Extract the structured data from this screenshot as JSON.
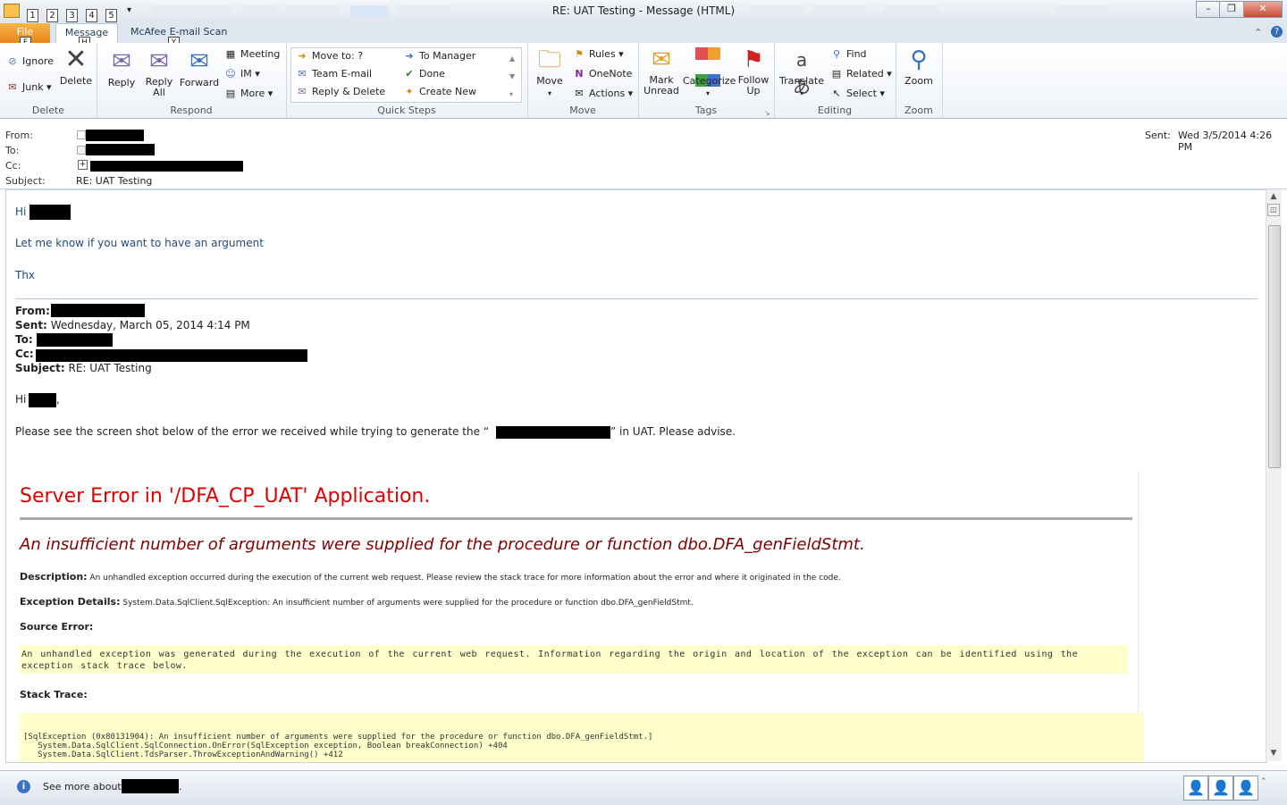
{
  "window": {
    "title": "RE: UAT Testing - Message (HTML)",
    "qat_badges": [
      "1",
      "2",
      "3",
      "4",
      "5"
    ],
    "btn_minimize": "–",
    "btn_restore": "❐",
    "btn_close": "✕"
  },
  "tabs": {
    "file": "File",
    "message": "Message",
    "mcafee": "McAfee E-mail Scan",
    "keytips": {
      "file": "F",
      "message": "H",
      "mcafee": "Y"
    }
  },
  "ribbon": {
    "delete_group": {
      "label": "Delete",
      "ignore": "Ignore",
      "junk": "Junk ▾",
      "delete": "Delete"
    },
    "respond_group": {
      "label": "Respond",
      "reply": "Reply",
      "reply_all": "Reply\nAll",
      "forward": "Forward",
      "meeting": "Meeting",
      "im": "IM ▾",
      "more": "More ▾"
    },
    "quick_steps_group": {
      "label": "Quick Steps",
      "move_to": "Move to: ?",
      "team_email": "Team E-mail",
      "reply_delete": "Reply & Delete",
      "to_manager": "To Manager",
      "done": "Done",
      "create_new": "Create New"
    },
    "move_group": {
      "label": "Move",
      "move": "Move",
      "rules": "Rules ▾",
      "onenote": "OneNote",
      "actions": "Actions ▾"
    },
    "tags_group": {
      "label": "Tags",
      "mark_unread": "Mark Unread",
      "categorize": "Categorize",
      "follow_up": "Follow Up"
    },
    "editing_group": {
      "label": "Editing",
      "translate": "Translate",
      "find": "Find",
      "related": "Related ▾",
      "select": "Select ▾"
    },
    "zoom_group": {
      "label": "Zoom",
      "zoom": "Zoom"
    }
  },
  "header": {
    "from_label": "From:",
    "to_label": "To:",
    "cc_label": "Cc:",
    "subject_label": "Subject:",
    "subject": "RE: UAT Testing",
    "sent_label": "Sent:",
    "sent_value": "Wed 3/5/2014 4:26 PM"
  },
  "body": {
    "greeting": "Hi",
    "line1": "Let me know if you want to have an argument",
    "thx": "Thx",
    "quoted": {
      "from_label": "From:",
      "sent_label": "Sent:",
      "sent_value": "Wednesday, March 05, 2014 4:14 PM",
      "to_label": "To:",
      "cc_label": "Cc:",
      "subject_label": "Subject:",
      "subject_value": "RE: UAT Testing",
      "greeting": "Hi",
      "greeting_comma": ",",
      "para_start": "Please see the screen shot below of the error we received while trying to generate the “",
      "para_end": "” in UAT.  Please advise."
    },
    "error": {
      "title": "Server Error in '/DFA_CP_UAT' Application.",
      "subtitle": "An insufficient number of arguments were supplied for the procedure or function dbo.DFA_genFieldStmt.",
      "description_label": "Description:",
      "description": "An unhandled exception occurred during the execution of the current web request. Please review the stack trace for more information about the error and where it originated in the code.",
      "exception_label": "Exception Details:",
      "exception": "System.Data.SqlClient.SqlException: An insufficient number of arguments were supplied for the procedure or function dbo.DFA_genFieldStmt.",
      "source_label": "Source Error:",
      "source_box": "An unhandled exception was generated during the execution of the current web request. Information regarding the origin and location of the exception can be identified using the exception stack trace below.",
      "stack_label": "Stack Trace:",
      "stack_lines": [
        "[SqlException (0x80131904): An insufficient number of arguments were supplied for the procedure or function dbo.DFA_genFieldStmt.]",
        "   System.Data.SqlClient.SqlConnection.OnError(SqlException exception, Boolean breakConnection) +404",
        "   System.Data.SqlClient.TdsParser.ThrowExceptionAndWarning() +412"
      ]
    }
  },
  "status": {
    "see_more": "See more about:",
    "see_more_end": "."
  }
}
